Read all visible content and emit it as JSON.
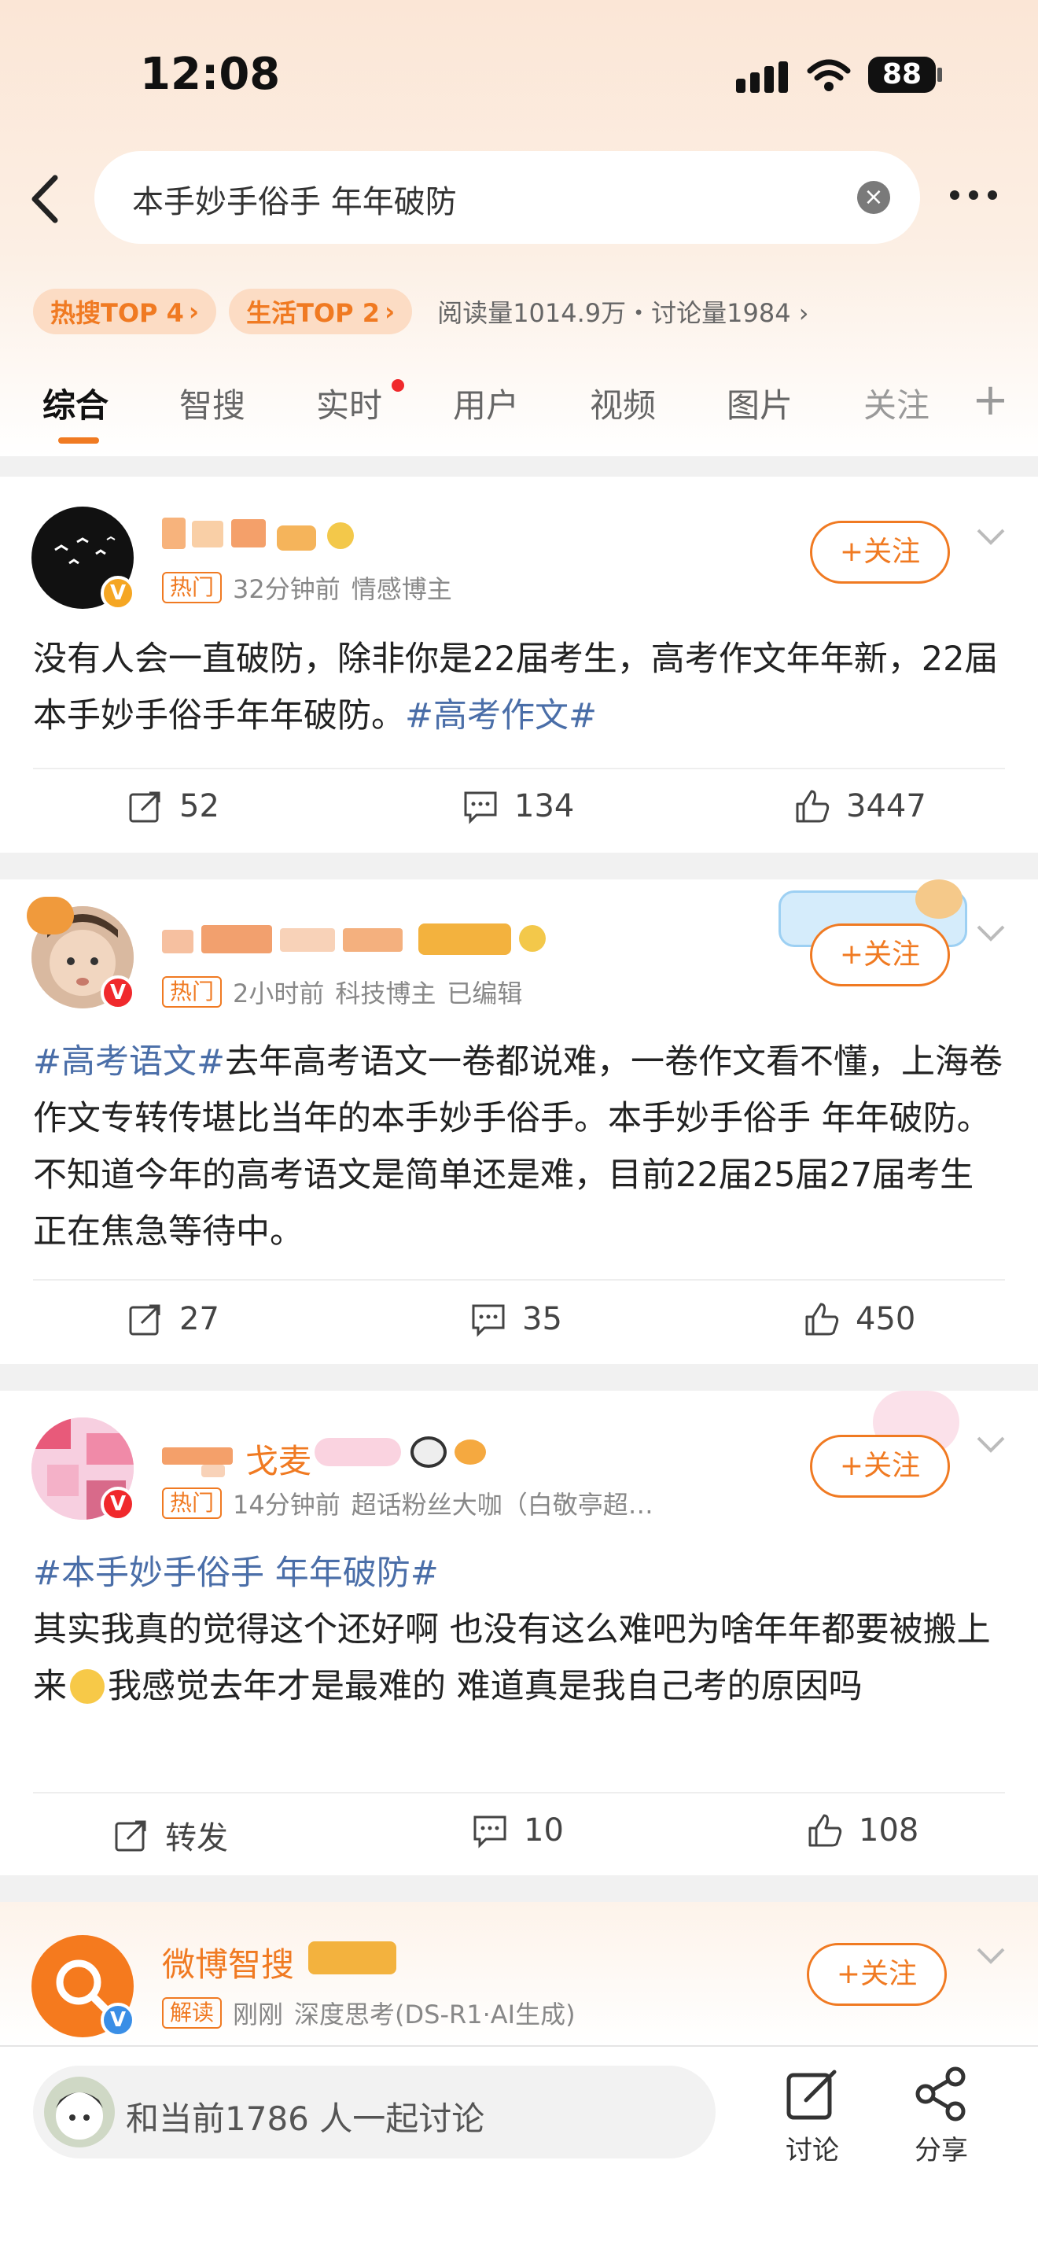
{
  "status_bar": {
    "time": "12:08",
    "battery": "88"
  },
  "search": {
    "query": "本手妙手俗手 年年破防"
  },
  "hot_info": {
    "chip1": "热搜TOP 4",
    "chip2": "生活TOP 2",
    "stats": "阅读量1014.9万・讨论量1984",
    "chevron": "›"
  },
  "tabs": [
    "综合",
    "智搜",
    "实时",
    "用户",
    "视频",
    "图片",
    "关注"
  ],
  "follow_label": "+关注",
  "posts": [
    {
      "hot_tag": "热门",
      "time": "32分钟前",
      "role": "情感博主",
      "text_plain": "没有人会一直破防，除非你是22届考生，高考作文年年新，22届本手妙手俗手年年破防。",
      "hashtag": "#高考作文#",
      "repost": "52",
      "comments": "134",
      "likes": "3447"
    },
    {
      "hot_tag": "热门",
      "time": "2小时前",
      "role": "科技博主",
      "edited": "已编辑",
      "hashtag": "#高考语文#",
      "text_plain": "去年高考语文一卷都说难，一卷作文看不懂，上海卷作文专转传堪比当年的本手妙手俗手。本手妙手俗手 年年破防。不知道今年的高考语文是简单还是难，目前22届25届27届考生正在焦急等待中。",
      "repost": "27",
      "comments": "35",
      "likes": "450"
    },
    {
      "hot_tag": "热门",
      "time": "14分钟前",
      "role": "超话粉丝大咖（白敬亭超…",
      "name_suffix": "戈麦",
      "hashtag": "#本手妙手俗手 年年破防#",
      "text_plain1": "其实我真的觉得这个还好啊 也没有这么难吧为啥年年都要被搬上来",
      "text_plain2": "我感觉去年才是最难的 难道真是我自己考的原因吗",
      "repost": "转发",
      "comments": "10",
      "likes": "108"
    },
    {
      "name": "微博智搜",
      "tag": "解读",
      "time": "刚刚",
      "role": "深度思考(DS-R1·AI生成)"
    }
  ],
  "bottom": {
    "discuss": "和当前1786 人一起讨论",
    "discuss_btn": "讨论",
    "share_btn": "分享"
  },
  "colors": {
    "accent": "#f07a22",
    "hashtag": "#4a6ea8",
    "text": "#222222"
  }
}
